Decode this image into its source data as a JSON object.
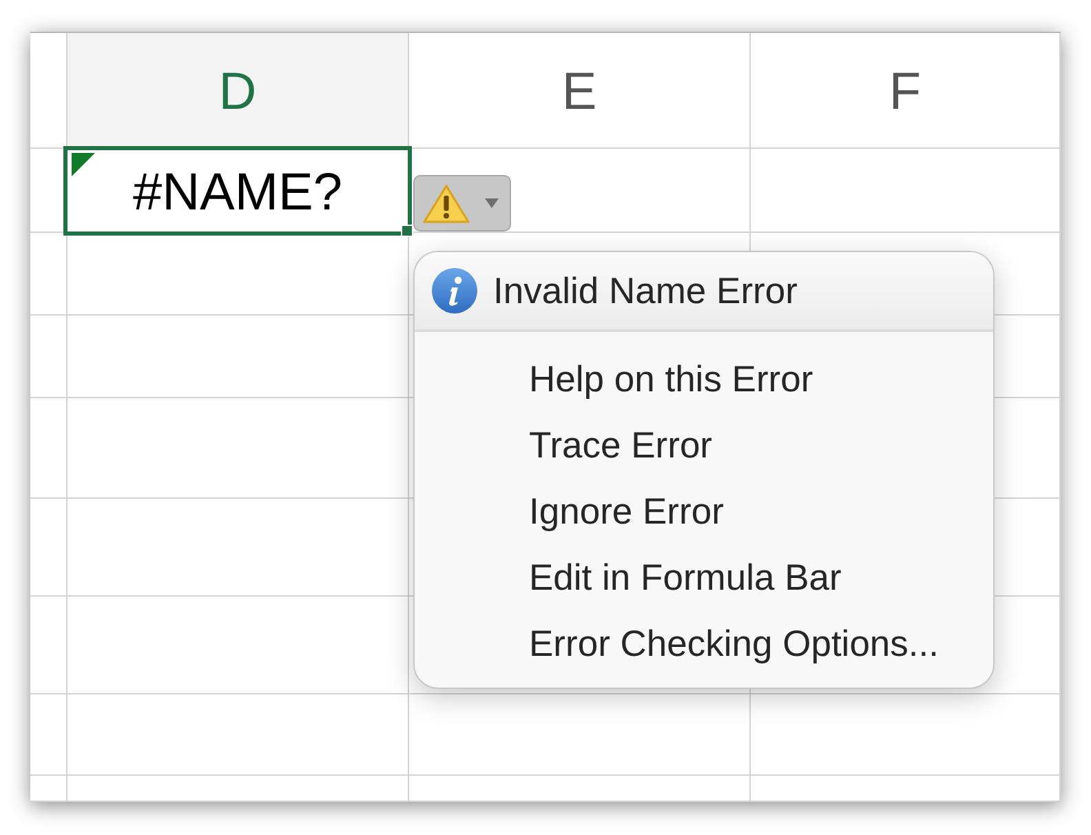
{
  "columns": [
    {
      "label": "D",
      "selected": true
    },
    {
      "label": "E",
      "selected": false
    },
    {
      "label": "F",
      "selected": false
    }
  ],
  "active_cell": {
    "value": "#NAME?",
    "error_indicator": true
  },
  "error_button": {
    "expanded": true
  },
  "error_menu": {
    "title": "Invalid Name Error",
    "items": [
      "Help on this Error",
      "Trace Error",
      "Ignore Error",
      "Edit in Formula Bar",
      "Error Checking Options..."
    ]
  }
}
